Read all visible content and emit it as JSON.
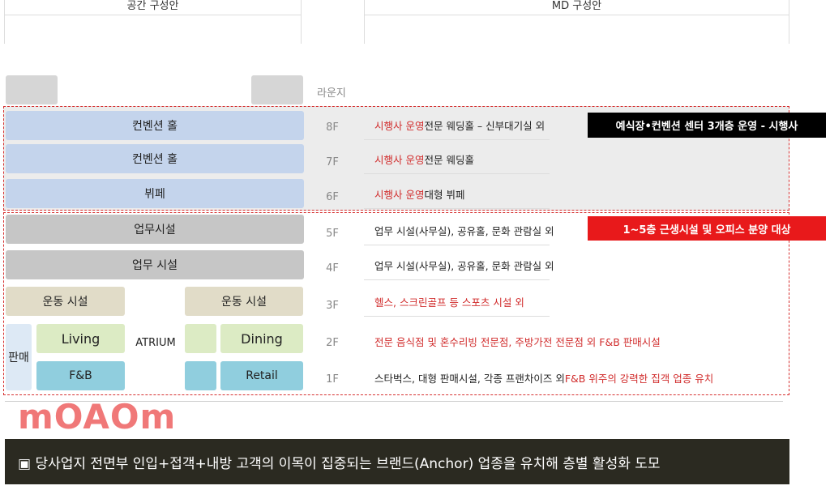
{
  "headers": {
    "space": "공간 구성안",
    "md": "MD 구성안"
  },
  "lounge_label": "라운지",
  "floors": [
    "8F",
    "7F",
    "6F",
    "5F",
    "4F",
    "3F",
    "2F",
    "1F"
  ],
  "blocks": {
    "f8": "컨벤션 홀",
    "f7": "컨벤션 홀",
    "f6": "뷔페",
    "f5": "업무시설",
    "f4": "업무 시설",
    "f3_left": "운동 시설",
    "f3_right": "운동 시설",
    "sales": "판매",
    "living": "Living",
    "atrium": "ATRIUM",
    "dining": "Dining",
    "fnb": "F&B",
    "retail": "Retail"
  },
  "md": {
    "f8_red": "시행사 운영",
    "f8_rest": " 전문 웨딩홀 – 신부대기실 외",
    "f7_red": "시행사 운영",
    "f7_rest": " 전문 웨딩홀",
    "f6_red": "시행사 운영",
    "f6_rest": " 대형 뷔페",
    "f5": "업무 시설(사무실), 공유홀, 문화 관람실 외",
    "f4": "업무 시설(사무실), 공유홀, 문화 관람실 외",
    "f3": "헬스, 스크린골프 등 스포츠 시설 외",
    "f2": "전문 음식점 및 혼수리빙 전문점, 주방가전 전문점 외 F&B 판매시설",
    "f1_black": "스타벅스, 대형 판매시설, 각종 프랜차이즈 외 ",
    "f1_red": "F&B 위주의 강력한 집객 업종 유치"
  },
  "tags": {
    "top": "예식장•컨벤션 센터 3개층 운영 - 시행사",
    "bottom": "1~5층 근생시설 및 오피스 분양 대상"
  },
  "watermark": "mOAOm",
  "footer": "▣ 당사업지 전면부 인입+접객+내방 고객의 이목이 집중되는 브랜드(Anchor) 업종을 유치해 층별 활성화 도모",
  "colors": {
    "accent_red": "#d12c2c",
    "tag_red": "#e8191b",
    "tag_black": "#000000",
    "footer_bg": "#2b2a21"
  }
}
